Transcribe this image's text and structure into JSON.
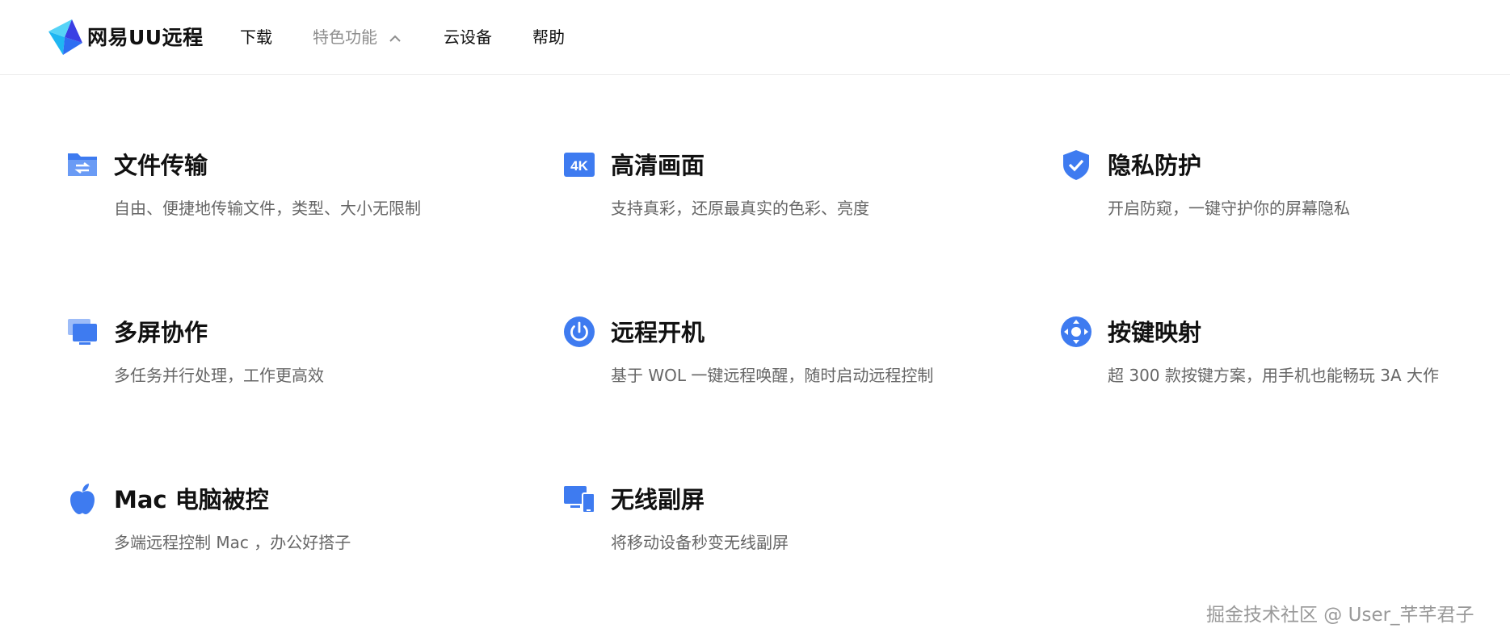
{
  "brand": {
    "name": "网易UU远程",
    "accent": "#3e7bf0"
  },
  "nav": [
    {
      "label": "下载",
      "active": false
    },
    {
      "label": "特色功能",
      "active": true,
      "icon": "chevron-up-icon"
    },
    {
      "label": "云设备",
      "active": false
    },
    {
      "label": "帮助",
      "active": false
    }
  ],
  "features": [
    {
      "icon": "folder-transfer-icon",
      "title": "文件传输",
      "desc": "自由、便捷地传输文件，类型、大小无限制"
    },
    {
      "icon": "4k-icon",
      "title": "高清画面",
      "desc": "支持真彩，还原最真实的色彩、亮度",
      "badge": "4K"
    },
    {
      "icon": "shield-check-icon",
      "title": "隐私防护",
      "desc": "开启防窥，一键守护你的屏幕隐私"
    },
    {
      "icon": "multi-screen-icon",
      "title": "多屏协作",
      "desc": "多任务并行处理，工作更高效"
    },
    {
      "icon": "power-icon",
      "title": "远程开机",
      "desc": "基于 WOL 一键远程唤醒，随时启动远程控制"
    },
    {
      "icon": "gamepad-icon",
      "title": "按键映射",
      "desc": "超 300 款按键方案，用手机也能畅玩 3A 大作"
    },
    {
      "icon": "apple-icon",
      "title": "Mac 电脑被控",
      "desc": "多端远程控制 Mac ，办公好搭子"
    },
    {
      "icon": "wireless-screen-icon",
      "title": "无线副屏",
      "desc": "将移动设备秒变无线副屏"
    }
  ],
  "watermark": "掘金技术社区 @ User_芊芊君子"
}
